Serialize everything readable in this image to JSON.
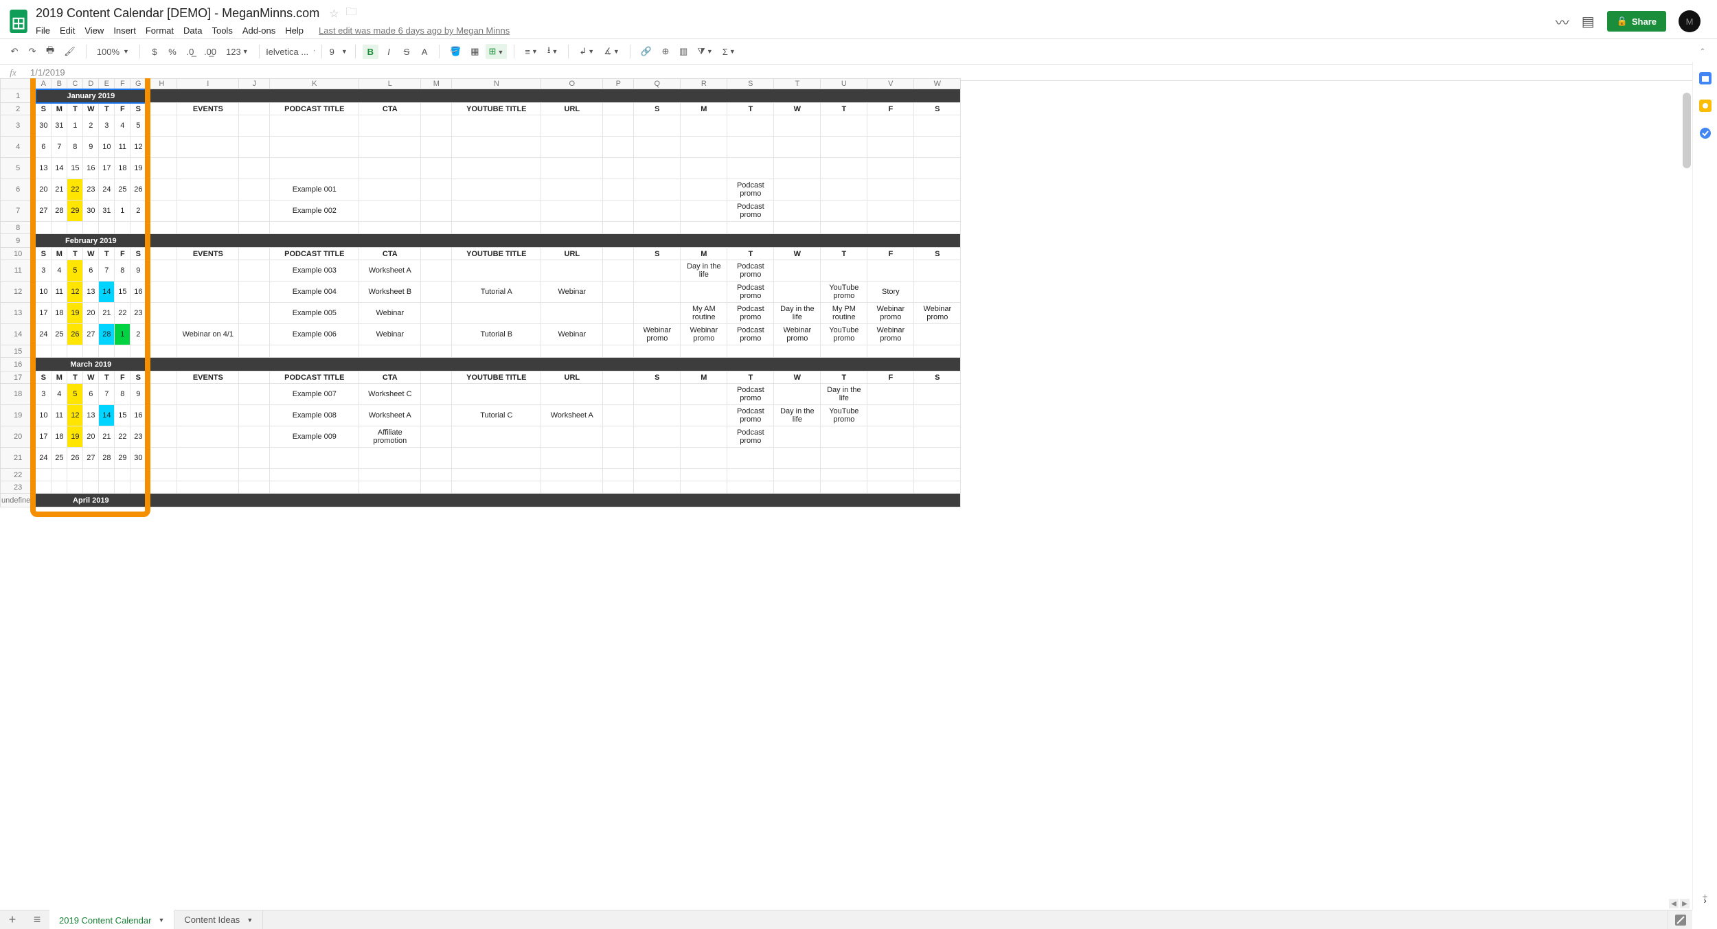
{
  "doc": {
    "title": "2019 Content Calendar [DEMO] - MeganMinns.com",
    "last_edit": "Last edit was made 6 days ago by Megan Minns"
  },
  "menus": [
    "File",
    "Edit",
    "View",
    "Insert",
    "Format",
    "Data",
    "Tools",
    "Add-ons",
    "Help"
  ],
  "share": "Share",
  "avatar": "M",
  "toolbar": {
    "zoom": "100%",
    "font": "Helvetica ...",
    "size": "9",
    "more": "123"
  },
  "fx_value": "1/1/2019",
  "columns_group1": [
    "A",
    "B",
    "C",
    "D",
    "E",
    "F",
    "G"
  ],
  "columns_rest": [
    "H",
    "I",
    "J",
    "K",
    "L",
    "M",
    "N",
    "O",
    "P",
    "Q",
    "R",
    "S",
    "T",
    "U",
    "V",
    "W"
  ],
  "col_widths_rest": [
    "w45",
    "w90",
    "w45",
    "w130",
    "w90",
    "w45",
    "w130",
    "w90",
    "w45",
    "w68",
    "w68",
    "w68",
    "w68",
    "w68",
    "w68",
    "w68"
  ],
  "row_numbers": [
    "1",
    "2",
    "3",
    "4",
    "5",
    "6",
    "7",
    "8",
    "9",
    "10",
    "11",
    "12",
    "13",
    "14",
    "15",
    "16",
    "17",
    "18",
    "19",
    "20",
    "21",
    "22",
    "23"
  ],
  "headers": {
    "events": "EVENTS",
    "podcast": "PODCAST TITLE",
    "cta": "CTA",
    "youtube": "YOUTUBE TITLE",
    "url": "URL",
    "days": [
      "S",
      "M",
      "T",
      "W",
      "T",
      "F",
      "S"
    ]
  },
  "months": {
    "jan": {
      "title": "January 2019",
      "weeks": [
        {
          "d": [
            "30",
            "31",
            "1",
            "2",
            "3",
            "4",
            "5"
          ],
          "hl": []
        },
        {
          "d": [
            "6",
            "7",
            "8",
            "9",
            "10",
            "11",
            "12"
          ],
          "hl": []
        },
        {
          "d": [
            "13",
            "14",
            "15",
            "16",
            "17",
            "18",
            "19"
          ],
          "hl": []
        },
        {
          "d": [
            "20",
            "21",
            "22",
            "23",
            "24",
            "25",
            "26"
          ],
          "hl": [
            {
              "i": 2,
              "c": "hl-yellow"
            }
          ],
          "podcast": "Example 001",
          "t": "Podcast promo"
        },
        {
          "d": [
            "27",
            "28",
            "29",
            "30",
            "31",
            "1",
            "2"
          ],
          "hl": [
            {
              "i": 2,
              "c": "hl-yellow"
            }
          ],
          "podcast": "Example 002",
          "t": "Podcast promo"
        }
      ]
    },
    "feb": {
      "title": "February 2019",
      "weeks": [
        {
          "d": [
            "3",
            "4",
            "5",
            "6",
            "7",
            "8",
            "9"
          ],
          "hl": [
            {
              "i": 2,
              "c": "hl-yellow"
            }
          ],
          "podcast": "Example 003",
          "cta": "Worksheet A",
          "m": "Day in the life",
          "t": "Podcast promo"
        },
        {
          "d": [
            "10",
            "11",
            "12",
            "13",
            "14",
            "15",
            "16"
          ],
          "hl": [
            {
              "i": 2,
              "c": "hl-yellow"
            },
            {
              "i": 4,
              "c": "hl-cyan"
            }
          ],
          "podcast": "Example 004",
          "cta": "Worksheet B",
          "yt": "Tutorial A",
          "url": "Webinar",
          "t": "Podcast promo",
          "th": "YouTube promo",
          "f": "Story"
        },
        {
          "d": [
            "17",
            "18",
            "19",
            "20",
            "21",
            "22",
            "23"
          ],
          "hl": [
            {
              "i": 2,
              "c": "hl-yellow"
            }
          ],
          "podcast": "Example 005",
          "cta": "Webinar",
          "m": "My AM routine",
          "t": "Podcast promo",
          "w": "Day in the life",
          "th": "My PM routine",
          "f": "Webinar promo",
          "sa": "Webinar promo"
        },
        {
          "d": [
            "24",
            "25",
            "26",
            "27",
            "28",
            "1",
            "2"
          ],
          "hl": [
            {
              "i": 2,
              "c": "hl-yellow"
            },
            {
              "i": 4,
              "c": "hl-cyan"
            },
            {
              "i": 5,
              "c": "hl-green"
            }
          ],
          "events": "Webinar on 4/1",
          "podcast": "Example 006",
          "cta": "Webinar",
          "yt": "Tutorial B",
          "url": "Webinar",
          "s": "Webinar promo",
          "m": "Webinar promo",
          "t": "Podcast promo",
          "w": "Webinar promo",
          "th": "YouTube promo",
          "f": "Webinar promo"
        }
      ]
    },
    "mar": {
      "title": "March 2019",
      "weeks": [
        {
          "d": [
            "3",
            "4",
            "5",
            "6",
            "7",
            "8",
            "9"
          ],
          "hl": [
            {
              "i": 2,
              "c": "hl-yellow"
            }
          ],
          "podcast": "Example 007",
          "cta": "Worksheet C",
          "t": "Podcast promo",
          "th": "Day in the life"
        },
        {
          "d": [
            "10",
            "11",
            "12",
            "13",
            "14",
            "15",
            "16"
          ],
          "hl": [
            {
              "i": 2,
              "c": "hl-yellow"
            },
            {
              "i": 4,
              "c": "hl-cyan"
            }
          ],
          "podcast": "Example 008",
          "cta": "Worksheet A",
          "yt": "Tutorial C",
          "url": "Worksheet A",
          "t": "Podcast promo",
          "w": "Day in the life",
          "th": "YouTube promo"
        },
        {
          "d": [
            "17",
            "18",
            "19",
            "20",
            "21",
            "22",
            "23"
          ],
          "hl": [
            {
              "i": 2,
              "c": "hl-yellow"
            }
          ],
          "podcast": "Example 009",
          "cta": "Affiliate promotion",
          "t": "Podcast promo"
        },
        {
          "d": [
            "24",
            "25",
            "26",
            "27",
            "28",
            "29",
            "30"
          ],
          "hl": []
        }
      ]
    },
    "apr": {
      "title": "April 2019"
    }
  },
  "tabs": {
    "active": "2019 Content Calendar",
    "other": "Content Ideas"
  }
}
